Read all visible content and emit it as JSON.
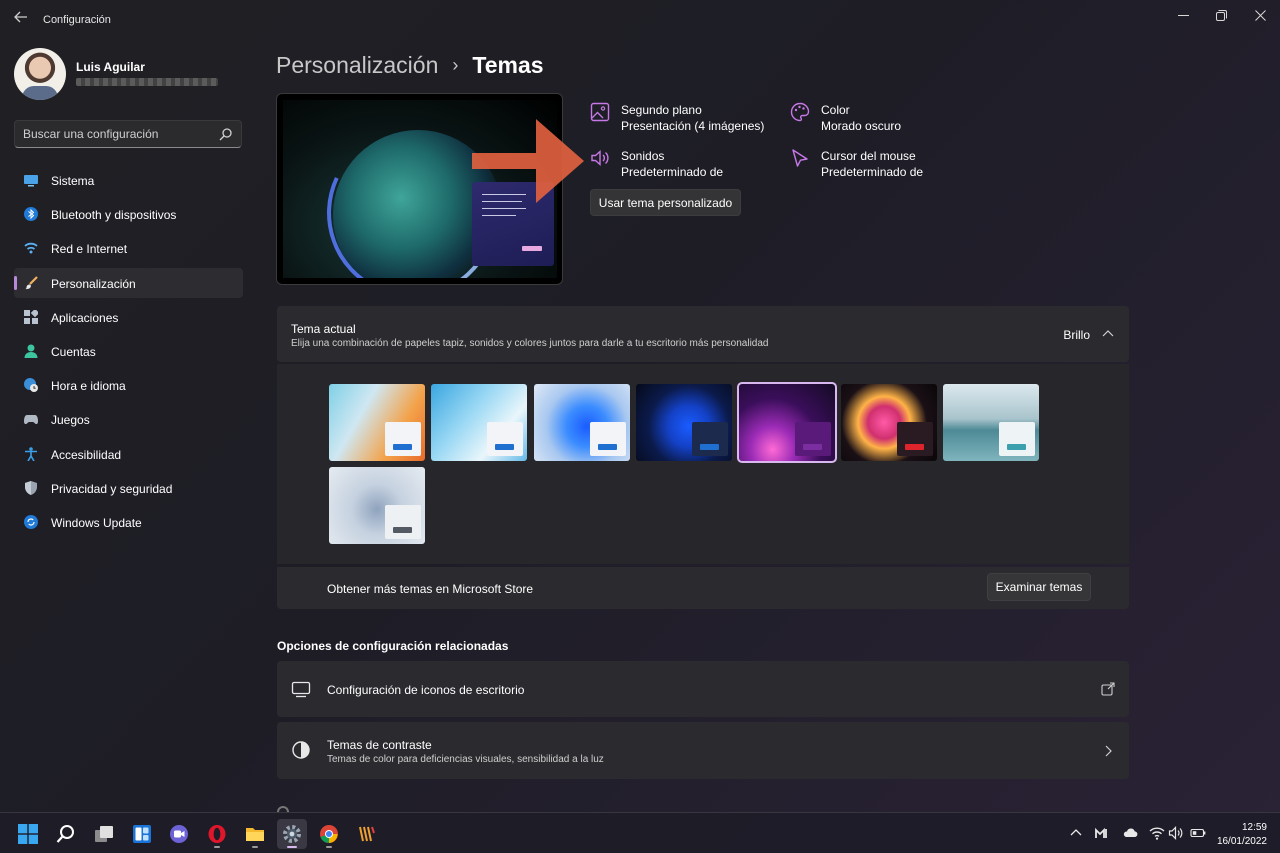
{
  "window": {
    "title": "Configuración"
  },
  "user": {
    "name": "Luis Aguilar"
  },
  "search": {
    "placeholder": "Buscar una configuración"
  },
  "sidebar": {
    "items": [
      {
        "label": "Sistema",
        "icon": "monitor-icon"
      },
      {
        "label": "Bluetooth y dispositivos",
        "icon": "bluetooth-icon"
      },
      {
        "label": "Red e Internet",
        "icon": "wifi-icon"
      },
      {
        "label": "Personalización",
        "icon": "paintbrush-icon",
        "active": true
      },
      {
        "label": "Aplicaciones",
        "icon": "apps-icon"
      },
      {
        "label": "Cuentas",
        "icon": "person-icon"
      },
      {
        "label": "Hora e idioma",
        "icon": "globe-clock-icon"
      },
      {
        "label": "Juegos",
        "icon": "gamepad-icon"
      },
      {
        "label": "Accesibilidad",
        "icon": "accessibility-icon"
      },
      {
        "label": "Privacidad y seguridad",
        "icon": "shield-icon"
      },
      {
        "label": "Windows Update",
        "icon": "update-icon"
      }
    ]
  },
  "breadcrumb": {
    "parent": "Personalización",
    "separator": "›",
    "current": "Temas"
  },
  "theme_props": {
    "background": {
      "title": "Segundo plano",
      "value": "Presentación (4 imágenes)"
    },
    "color": {
      "title": "Color",
      "value": "Morado oscuro"
    },
    "sounds": {
      "title": "Sonidos",
      "value": "Predeterminado de"
    },
    "cursor": {
      "title": "Cursor del mouse",
      "value": "Predeterminado de"
    },
    "use_button": "Usar tema personalizado"
  },
  "current_theme": {
    "title": "Tema actual",
    "subtitle": "Elija una combinación de papeles tapiz, sonidos y colores juntos para darle a tu escritorio más personalidad",
    "selected_label": "Brillo"
  },
  "themes_store": {
    "label": "Obtener más temas en Microsoft Store",
    "button": "Examinar temas"
  },
  "related": {
    "title": "Opciones de configuración relacionadas",
    "desktop_icons": "Configuración de iconos de escritorio",
    "contrast_title": "Temas de contraste",
    "contrast_sub": "Temas de color para deficiencias visuales, sensibilidad a la luz"
  },
  "clock": {
    "time": "12:59",
    "date": "16/01/2022"
  },
  "colors": {
    "accent": "#b78ad9",
    "annotation_arrow": "#e0613f"
  }
}
